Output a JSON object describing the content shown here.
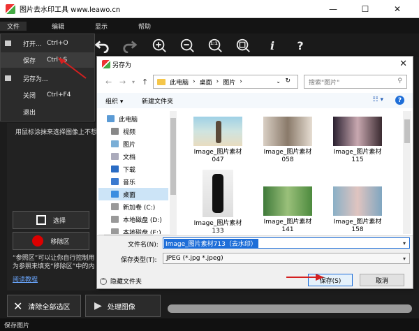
{
  "window": {
    "title": "图片去水印工具 www.leawo.cn",
    "controls": [
      "—",
      "☐",
      "✕"
    ]
  },
  "menubar": [
    "文件",
    "编辑",
    "显示",
    "帮助"
  ],
  "file_menu": [
    {
      "label": "打开...",
      "shortcut": "Ctrl+O"
    },
    {
      "label": "保存",
      "shortcut": "Ctrl+S"
    },
    {
      "label": "另存为...",
      "shortcut": ""
    },
    {
      "label": "关闭",
      "shortcut": "Ctrl+F4"
    },
    {
      "label": "退出",
      "shortcut": ""
    }
  ],
  "toolbar": {
    "zoom_fit_label": "1:1",
    "info_label": "i",
    "help_label": "?"
  },
  "left_panel": {
    "hint": "用鼠标涂抹来选择图像上不想",
    "select_button": "选择",
    "remove_button": "移除区",
    "desc_line1": "“参照区”可以让你自行控制用",
    "desc_line2": "为参照来填充“移除区”中的内",
    "tutorial_link": "阅读教程"
  },
  "bottom_buttons": {
    "clear_all": "清除全部选区",
    "process": "处理图像"
  },
  "status": "保存图片",
  "dialog": {
    "title": "另存为",
    "address": [
      "此电脑",
      "桌面",
      "图片"
    ],
    "search_placeholder": "搜索\"图片\"",
    "organize": "组织 ▾",
    "new_folder": "新建文件夹",
    "view": "☷ ▾",
    "help": "?",
    "nav_items": [
      "此电脑",
      "视频",
      "图片",
      "文档",
      "下载",
      "音乐",
      "桌面",
      "新加卷 (C:)",
      "本地磁盘 (D:)",
      "本地磁盘 (E:)"
    ],
    "files": [
      {
        "name": "Image_图片素材047",
        "line1": "Image_图片素材",
        "line2": "047"
      },
      {
        "name": "Image_图片素材058",
        "line1": "Image_图片素材",
        "line2": "058"
      },
      {
        "name": "Image_图片素材115",
        "line1": "Image_图片素材",
        "line2": "115"
      },
      {
        "name": "Image_图片素材133",
        "line1": "Image_图片素材",
        "line2": "133"
      },
      {
        "name": "Image_图片素材141",
        "line1": "Image_图片素材",
        "line2": "141"
      },
      {
        "name": "Image_图片素材158",
        "line1": "Image_图片素材",
        "line2": "158"
      }
    ],
    "filename_label": "文件名(N):",
    "filename_value": "Image_图片素材713（去水印）",
    "filetype_label": "保存类型(T):",
    "filetype_value": "JPEG (*.jpg *.jpeg)",
    "hide_folders": "隐藏文件夹",
    "save_button": "保存(S)",
    "cancel_button": "取消"
  },
  "colors": {
    "dark_bg": "#1c1c1c",
    "selection_blue": "#1e6ed8",
    "annotation_red": "#d42020"
  }
}
